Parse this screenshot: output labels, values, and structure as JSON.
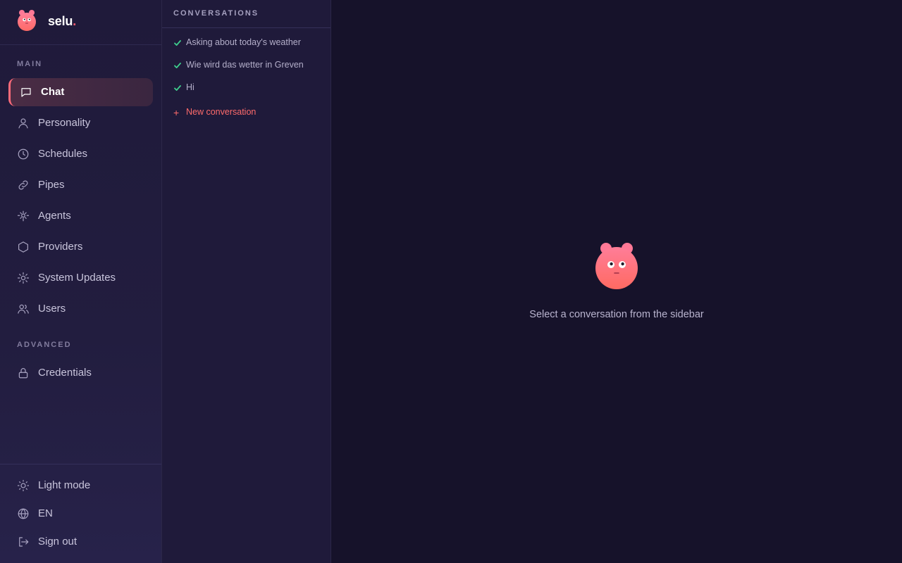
{
  "brand": {
    "name": "selu",
    "dot": "."
  },
  "nav": {
    "main_label": "MAIN",
    "advanced_label": "ADVANCED",
    "items": [
      {
        "label": "Chat",
        "icon": "chat-icon",
        "active": true
      },
      {
        "label": "Personality",
        "icon": "user-icon"
      },
      {
        "label": "Schedules",
        "icon": "clock-icon"
      },
      {
        "label": "Pipes",
        "icon": "link-icon"
      },
      {
        "label": "Agents",
        "icon": "agent-icon"
      },
      {
        "label": "Providers",
        "icon": "hexagon-icon"
      },
      {
        "label": "System Updates",
        "icon": "gear-icon"
      },
      {
        "label": "Users",
        "icon": "users-icon"
      }
    ],
    "advanced_items": [
      {
        "label": "Credentials",
        "icon": "lock-icon"
      }
    ],
    "footer": [
      {
        "label": "Light mode",
        "icon": "sun-icon"
      },
      {
        "label": "EN",
        "icon": "globe-icon"
      },
      {
        "label": "Sign out",
        "icon": "sign-out-icon"
      }
    ]
  },
  "conversations": {
    "title": "CONVERSATIONS",
    "items": [
      "Asking about today's weather",
      "Wie wird das wetter in Greven",
      "Hi"
    ],
    "new_label": "New conversation",
    "new_icon": "plus-icon"
  },
  "main": {
    "empty_text": "Select a conversation from the sidebar"
  },
  "colors": {
    "accent": "#ff6b7a",
    "success": "#3ecf8e",
    "background": "#16122a",
    "sidebar": "#1f1a3a"
  }
}
